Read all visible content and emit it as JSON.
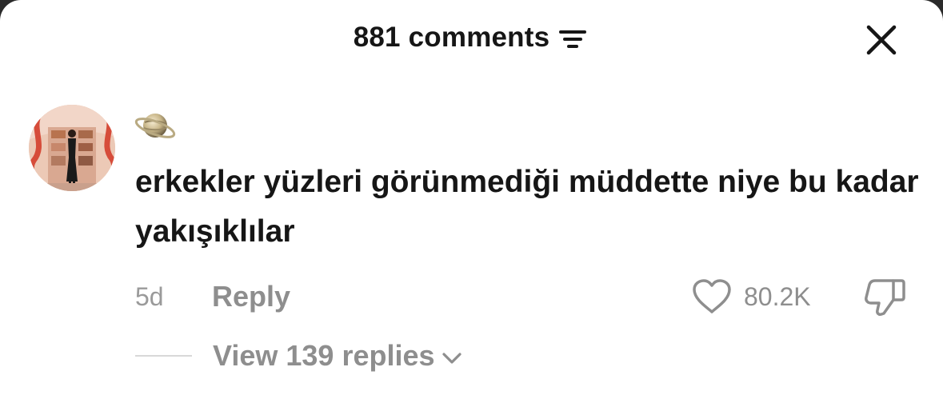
{
  "header": {
    "title": "881 comments",
    "sort_icon": "sort-lines-icon",
    "close_icon": "close-icon"
  },
  "comment": {
    "avatar": "user-avatar",
    "username_emoji": "ringed-planet-emoji",
    "text": "erkekler yüzleri görünmediği müddette niye bu kadar yakışıklılar",
    "timestamp": "5d",
    "reply_label": "Reply",
    "like_count": "80.2K",
    "like_icon": "heart-icon",
    "dislike_icon": "thumbs-down-icon"
  },
  "replies": {
    "label": "View 139 replies",
    "icon": "chevron-down-icon"
  },
  "colors": {
    "text_primary": "#161616",
    "text_secondary": "#8e8e8e",
    "background": "#ffffff"
  }
}
